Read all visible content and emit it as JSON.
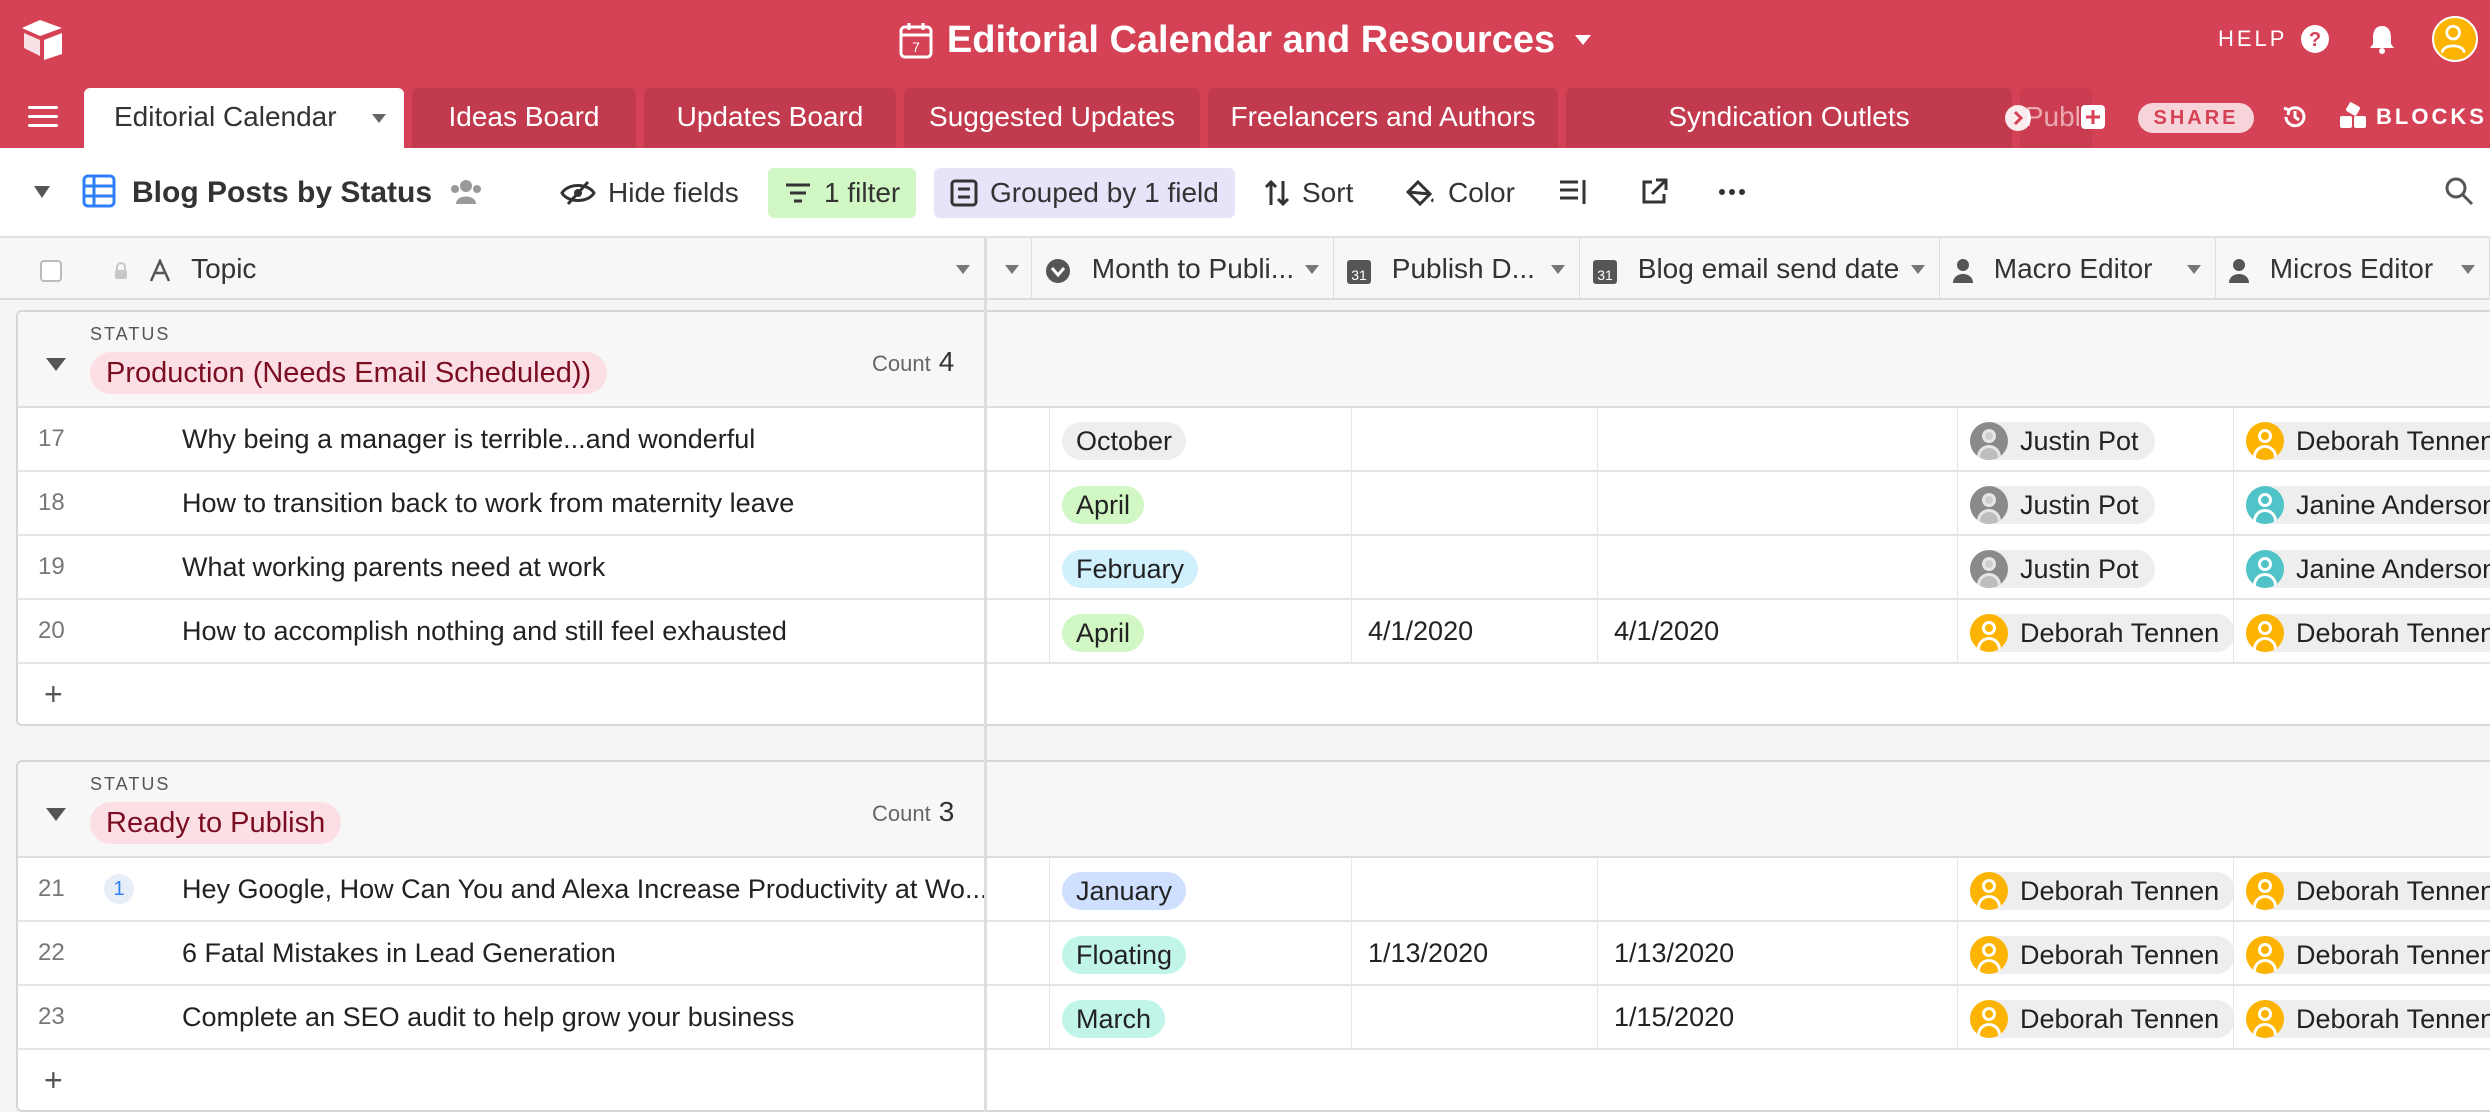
{
  "app": {
    "base_title": "Editorial Calendar and Resources",
    "help_label": "HELP",
    "share_label": "SHARE",
    "blocks_label": "BLOCKS",
    "accent_color": "#d54155"
  },
  "tabs": [
    {
      "label": "Editorial Calendar",
      "active": true
    },
    {
      "label": "Ideas Board"
    },
    {
      "label": "Updates Board"
    },
    {
      "label": "Suggested Updates"
    },
    {
      "label": "Freelancers and Authors"
    },
    {
      "label": "Syndication Outlets"
    },
    {
      "label": "Publi"
    }
  ],
  "view": {
    "name": "Blog Posts by Status",
    "hide_fields": "Hide fields",
    "filter": "1 filter",
    "group": "Grouped by 1 field",
    "sort": "Sort",
    "color": "Color"
  },
  "columns": {
    "topic": "Topic",
    "month": "Month to Publi...",
    "publish_date": "Publish D...",
    "email_date": "Blog email send date",
    "macro_editor": "Macro Editor",
    "micros_editor": "Micros Editor"
  },
  "groups": [
    {
      "label": "STATUS",
      "status": "Production (Needs Email Scheduled))",
      "count_label": "Count",
      "count": "4",
      "rows": [
        {
          "num": "17",
          "topic": "Why being a manager is terrible...and wonderful",
          "month": "October",
          "month_color": "#eeeeee",
          "publish": "",
          "email": "",
          "macro": "Justin Pot",
          "macro_avatar": "photo",
          "micro": "Deborah Tennen",
          "micro_avatar": "yellow"
        },
        {
          "num": "18",
          "topic": "How to transition back to work from maternity leave",
          "month": "April",
          "month_color": "#d1f7c4",
          "publish": "",
          "email": "",
          "macro": "Justin Pot",
          "macro_avatar": "photo",
          "micro": "Janine Anderson",
          "micro_avatar": "teal"
        },
        {
          "num": "19",
          "topic": "What working parents need at work",
          "month": "February",
          "month_color": "#d0f0fd",
          "publish": "",
          "email": "",
          "macro": "Justin Pot",
          "macro_avatar": "photo",
          "micro": "Janine Anderson",
          "micro_avatar": "teal"
        },
        {
          "num": "20",
          "topic": "How to accomplish nothing and still feel exhausted",
          "month": "April",
          "month_color": "#d1f7c4",
          "publish": "4/1/2020",
          "email": "4/1/2020",
          "macro": "Deborah Tennen",
          "macro_avatar": "yellow",
          "micro": "Deborah Tennen",
          "micro_avatar": "yellow"
        }
      ]
    },
    {
      "label": "STATUS",
      "status": "Ready to Publish",
      "count_label": "Count",
      "count": "3",
      "rows": [
        {
          "num": "21",
          "comments": "1",
          "topic": "Hey Google, How Can You and Alexa Increase Productivity at Wo...",
          "month": "January",
          "month_color": "#cfdfff",
          "publish": "",
          "email": "",
          "macro": "Deborah Tennen",
          "macro_avatar": "yellow",
          "micro": "Deborah Tennen",
          "micro_avatar": "yellow"
        },
        {
          "num": "22",
          "topic": "6 Fatal Mistakes in Lead Generation",
          "month": "Floating",
          "month_color": "#c2f5e9",
          "publish": "1/13/2020",
          "email": "1/13/2020",
          "macro": "Deborah Tennen",
          "macro_avatar": "yellow",
          "micro": "Deborah Tennen",
          "micro_avatar": "yellow"
        },
        {
          "num": "23",
          "topic": "Complete an SEO audit to help grow your business",
          "month": "March",
          "month_color": "#c2f5e9",
          "publish": "",
          "email": "1/15/2020",
          "macro": "Deborah Tennen",
          "macro_avatar": "yellow",
          "micro": "Deborah Tennen",
          "micro_avatar": "yellow"
        }
      ]
    }
  ]
}
